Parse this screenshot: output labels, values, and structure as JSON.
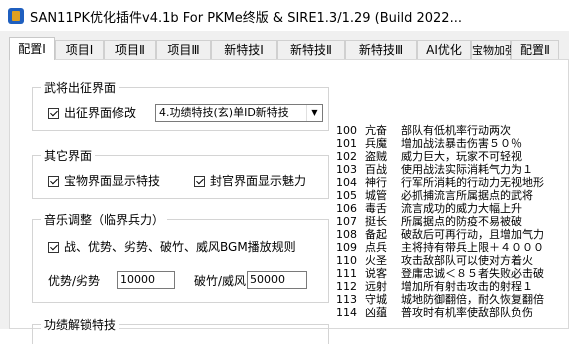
{
  "window": {
    "title": "SAN11PK优化插件v4.1b  For PKMe终版 & SIRE1.3/1.29  (Build 2022..."
  },
  "tabs": [
    "配置Ⅰ",
    "项目Ⅰ",
    "项目Ⅱ",
    "项目Ⅲ",
    "新特技Ⅰ",
    "新特技Ⅱ",
    "新特技Ⅲ",
    "AI优化",
    "宝物加强",
    "配置Ⅱ"
  ],
  "groups": {
    "deploy": {
      "title": "武将出征界面",
      "checkbox_label": "出征界面修改",
      "checked": true,
      "select_value": "4.功绩特技(玄)单ID新特技"
    },
    "other": {
      "title": "其它界面",
      "cb1_label": "宝物界面显示特技",
      "cb2_label": "封官界面显示魅力"
    },
    "music": {
      "title": "音乐调整（临界兵力）",
      "checkbox_label": "战、优势、劣势、破竹、威风BGM播放规则",
      "adv_label": "优势/劣势",
      "adv_value": "10000",
      "break_label": "破竹/威风",
      "break_value": "50000"
    },
    "unlock": {
      "title": "功绩解锁特技"
    }
  },
  "skills": [
    {
      "num": "100",
      "name": "亢奋",
      "desc": "部队有低机率行动两次"
    },
    {
      "num": "101",
      "name": "兵魔",
      "desc": "增加战法暴击伤害５０％"
    },
    {
      "num": "102",
      "name": "盗贼",
      "desc": "威力巨大，玩家不可轻视"
    },
    {
      "num": "103",
      "name": "百战",
      "desc": "使用战法实际消耗气力为１"
    },
    {
      "num": "104",
      "name": "神行",
      "desc": "行军所消耗的行动力无视地形"
    },
    {
      "num": "105",
      "name": "城管",
      "desc": "必抓捕流言所属据点的武将"
    },
    {
      "num": "106",
      "name": "毒舌",
      "desc": "流言成功的威力大幅上升"
    },
    {
      "num": "107",
      "name": "挺长",
      "desc": "所属据点的防疫不易被破"
    },
    {
      "num": "108",
      "name": "备起",
      "desc": "破敌后可再行动，且增加气力"
    },
    {
      "num": "109",
      "name": "点兵",
      "desc": "主将持有带兵上限＋４０００"
    },
    {
      "num": "110",
      "name": "火圣",
      "desc": "攻击敌部队可以使对方着火"
    },
    {
      "num": "111",
      "name": "说客",
      "desc": "登庸忠诚＜８５者失败必击破"
    },
    {
      "num": "112",
      "name": "远射",
      "desc": "增加所有射击攻击的射程１"
    },
    {
      "num": "113",
      "name": "守城",
      "desc": "城地防御翻倍，耐久恢复翻倍"
    },
    {
      "num": "114",
      "name": "凶蕴",
      "desc": "普攻时有机率使敌部队负伤"
    }
  ]
}
